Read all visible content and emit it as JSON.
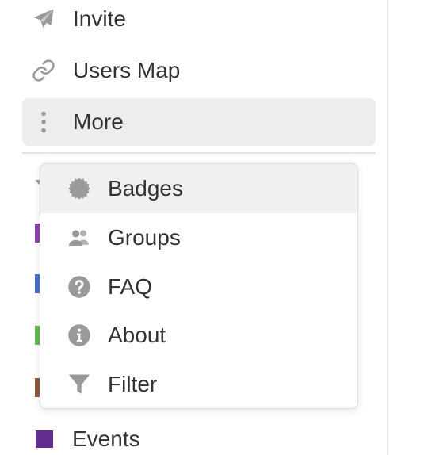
{
  "sidebar": {
    "items": [
      {
        "label": "Invite",
        "icon": "paper-plane-icon"
      },
      {
        "label": "Users Map",
        "icon": "link-icon"
      },
      {
        "label": "More",
        "icon": "vertical-ellipsis-icon",
        "active": true
      }
    ],
    "category_colors": [
      "#8e44ad",
      "#4a6fc9",
      "#62b551",
      "#8a5a3c"
    ],
    "events": {
      "label": "Events",
      "color": "#652d90"
    }
  },
  "more_menu": {
    "items": [
      {
        "label": "Badges",
        "icon": "badge-icon",
        "hovered": true
      },
      {
        "label": "Groups",
        "icon": "users-icon"
      },
      {
        "label": "FAQ",
        "icon": "question-circle-icon"
      },
      {
        "label": "About",
        "icon": "info-circle-icon"
      },
      {
        "label": "Filter",
        "icon": "filter-icon"
      }
    ]
  },
  "colors": {
    "icon_gray": "#9a9a9a",
    "text": "#333333",
    "active_bg": "#ededed",
    "hover_bg": "#f0f0f0"
  }
}
